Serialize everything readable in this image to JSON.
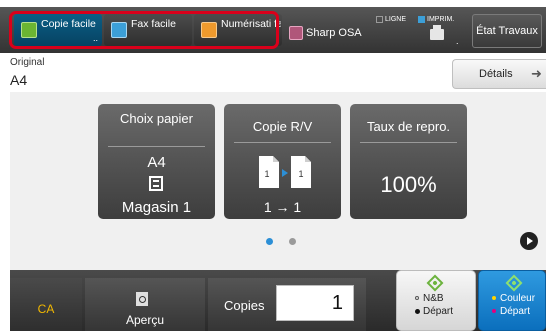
{
  "header": {
    "modes": [
      {
        "label": "Copie facile",
        "icon": "copy-mode-icon",
        "active": true
      },
      {
        "label": "Fax facile",
        "icon": "fax-mode-icon",
        "active": false
      },
      {
        "label": "Numérisati facile",
        "icon": "scan-mode-icon",
        "active": false
      }
    ],
    "osa_label": "Sharp OSA",
    "line_indicator": "LIGNE",
    "print_indicator": "IMPRIM.",
    "job_status_label": "État Travaux"
  },
  "original": {
    "label": "Original",
    "value": "A4"
  },
  "details_label": "Détails",
  "tiles": {
    "paper": {
      "title": "Choix papier",
      "size": "A4",
      "tray": "Magasin 1"
    },
    "duplex": {
      "title": "Copie R/V",
      "value": "1 → 1"
    },
    "ratio": {
      "title": "Taux de repro.",
      "value": "100%"
    }
  },
  "pager": {
    "pages": 2,
    "current": 1
  },
  "bottom": {
    "ca_label": "CA",
    "preview_label": "Aperçu",
    "copies_label": "Copies",
    "copies_value": "1",
    "bw_start": {
      "line1": "N&B",
      "line2": "Départ"
    },
    "color_start": {
      "line1": "Couleur",
      "line2": "Départ"
    }
  },
  "colors": {
    "highlight": "#d9001b",
    "active_mode": "#0b5f86",
    "ca_text": "#f2b800",
    "color_start": "#1a85d0",
    "page_dot_active": "#2c8fd6"
  }
}
